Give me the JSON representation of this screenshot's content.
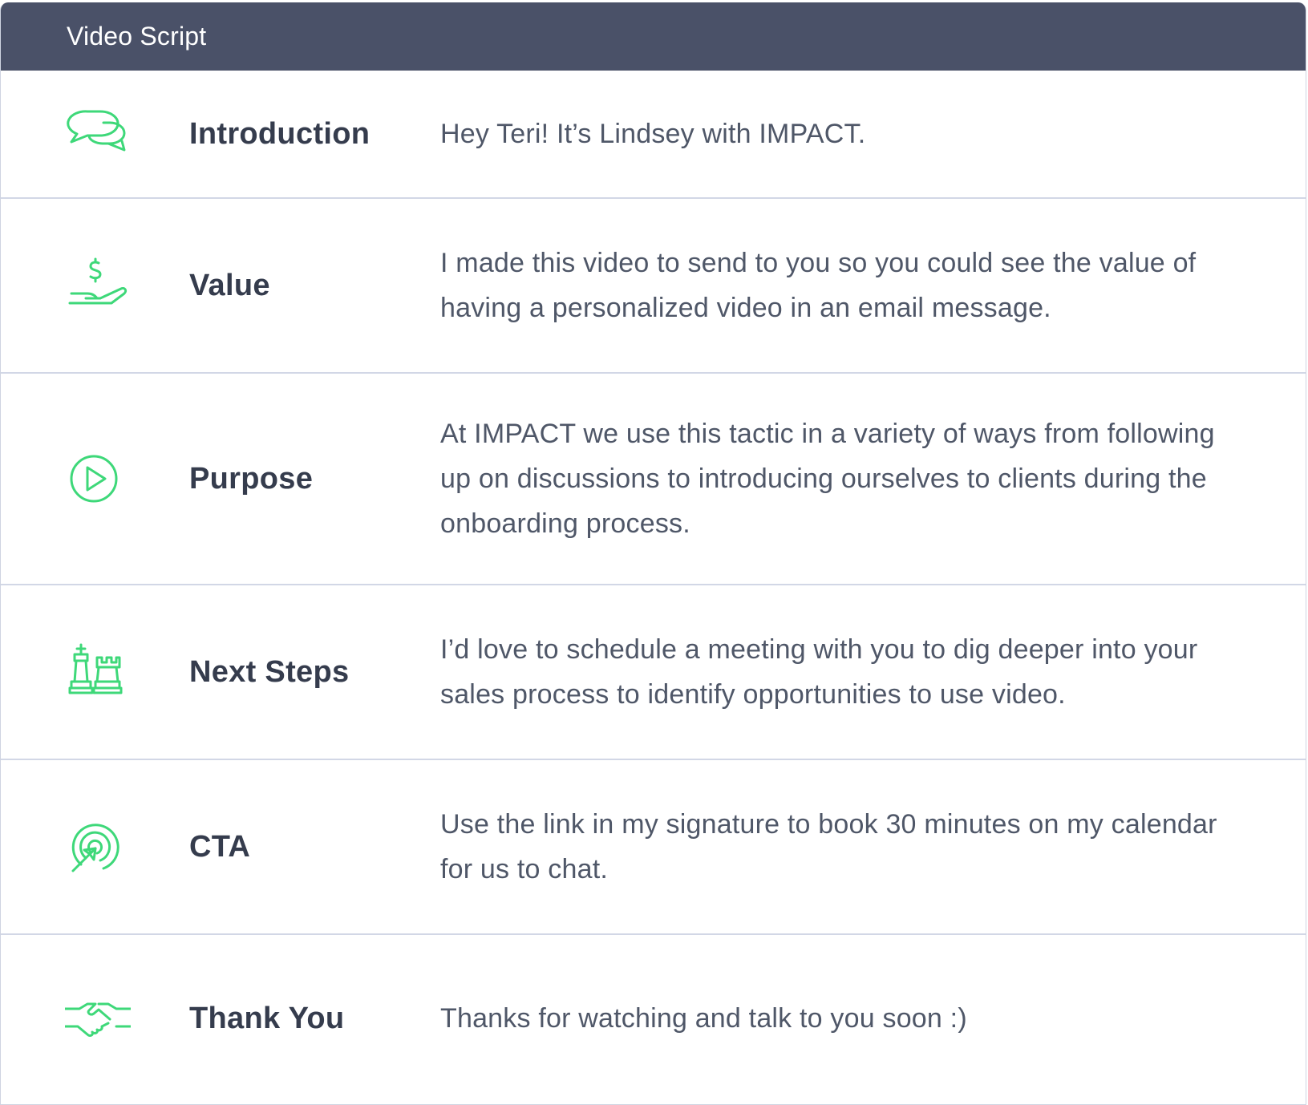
{
  "header": {
    "title": "Video Script"
  },
  "colors": {
    "header_bg": "#4a5168",
    "accent": "#3ed879",
    "divider": "#d2d7e6"
  },
  "rows": [
    {
      "icon": "chat-bubbles-icon",
      "label": "Introduction",
      "text": "Hey Teri! It’s Lindsey with IMPACT."
    },
    {
      "icon": "hand-dollar-icon",
      "label": "Value",
      "text": "I made this video to send to you so you could see the value of having a personalized video in an email message."
    },
    {
      "icon": "play-circle-icon",
      "label": "Purpose",
      "text": "At IMPACT we use this tactic in a variety of ways from following up on discussions to introducing ourselves to clients during the onboarding process."
    },
    {
      "icon": "chess-pieces-icon",
      "label": "Next Steps",
      "text": "I’d love to schedule a meeting with you to dig deeper into your sales process to identify opportunities to use video."
    },
    {
      "icon": "target-cursor-icon",
      "label": "CTA",
      "text": "Use the link in my signature to book 30 minutes on my calendar for us to chat."
    },
    {
      "icon": "handshake-icon",
      "label": "Thank You",
      "text": "Thanks for watching and talk to you soon :)"
    }
  ]
}
